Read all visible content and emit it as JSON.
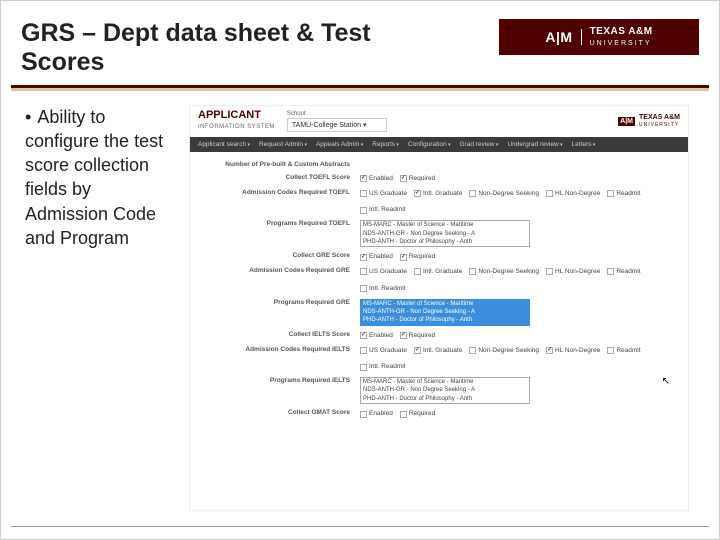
{
  "title": "GRS – Dept data sheet & Test Scores",
  "logo": {
    "atm": "A|M",
    "university": "TEXAS A&M",
    "sub": "UNIVERSITY"
  },
  "bullet": "Ability to configure the test score collection fields by Admission Code and Program",
  "app": {
    "name": "APPLICANT",
    "sub": "INFORMATION SYSTEM",
    "school_label": "School:",
    "school_value": "TAMU-College Station ▾",
    "tamu_mini": "TEXAS A&M"
  },
  "nav": [
    "Applicant search",
    "Request Admin",
    "Appeals Admin",
    "Reports",
    "Configuration",
    "Grad review",
    "Undergrad review",
    "Letters"
  ],
  "rows": {
    "r0": {
      "label": "Number of Pre-built & Custom Abstracts"
    },
    "r1": {
      "label": "Collect TOEFL Score",
      "enabled": "Enabled",
      "required": "Required"
    },
    "r2": {
      "label": "Admission Codes Required TOEFL"
    },
    "r3": {
      "label": "Programs Required TOEFL"
    },
    "r4": {
      "label": "Collect GRE Score",
      "enabled": "Enabled",
      "required": "Required"
    },
    "r5": {
      "label": "Admission Codes Required GRE"
    },
    "r6": {
      "label": "Programs Required GRE"
    },
    "r7": {
      "label": "Collect IELTS Score",
      "enabled": "Enabled",
      "required": "Required"
    },
    "r8": {
      "label": "Admission Codes Required IELTS"
    },
    "r9": {
      "label": "Programs Required IELTS"
    },
    "r10": {
      "label": "Collect GMAT Score",
      "enabled": "Enabled",
      "required": "Required"
    }
  },
  "codes": {
    "c0": "US Graduate",
    "c1": "Intl. Graduate",
    "c2": "Non-Degree Seeking",
    "c3": "HL Non-Degree",
    "c4": "Readmit",
    "c5": "Intl. Readmit"
  },
  "programs": {
    "p0": "MS-MARC - Master of Science - Maritime",
    "p1": "NDS-ANTH-GR - Non Degree Seeking - A",
    "p2": "PHD-ANTH - Doctor of Philosophy - Anth"
  }
}
